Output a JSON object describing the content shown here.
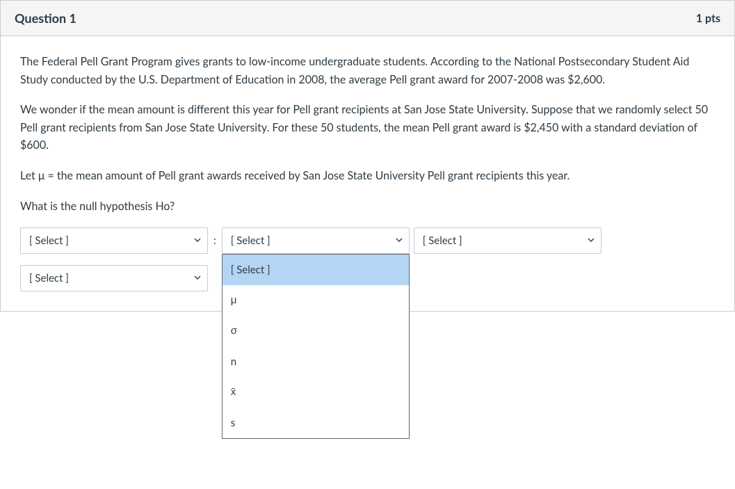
{
  "header": {
    "title": "Question 1",
    "points": "1 pts"
  },
  "body": {
    "p1": "The Federal Pell Grant Program gives grants to low-income undergraduate students. According to the National Postsecondary Student Aid Study conducted by the U.S. Department of Education in 2008, the average Pell grant award for 2007-2008 was $2,600.",
    "p2": "We wonder if the mean amount is different this year for Pell grant recipients at San Jose State University. Suppose that we randomly select 50 Pell grant recipients from San Jose State University. For these 50 students, the mean Pell grant award is $2,450 with a standard deviation of $600.",
    "p3": "Let μ = the mean amount of Pell grant awards received by San Jose State University Pell grant recipients this year.",
    "p4": "What is the null hypothesis Ho?"
  },
  "selects": {
    "placeholder": "[ Select ]",
    "colon": ":",
    "row1": {
      "s1": "[ Select ]",
      "s2": "[ Select ]",
      "s3": "[ Select ]"
    },
    "row2": {
      "s4": "[ Select ]"
    }
  },
  "dropdown": {
    "options": {
      "o0": "[ Select ]",
      "o1": "μ",
      "o2": "σ",
      "o3": "n",
      "o4": "x̄",
      "o5": "s"
    }
  }
}
